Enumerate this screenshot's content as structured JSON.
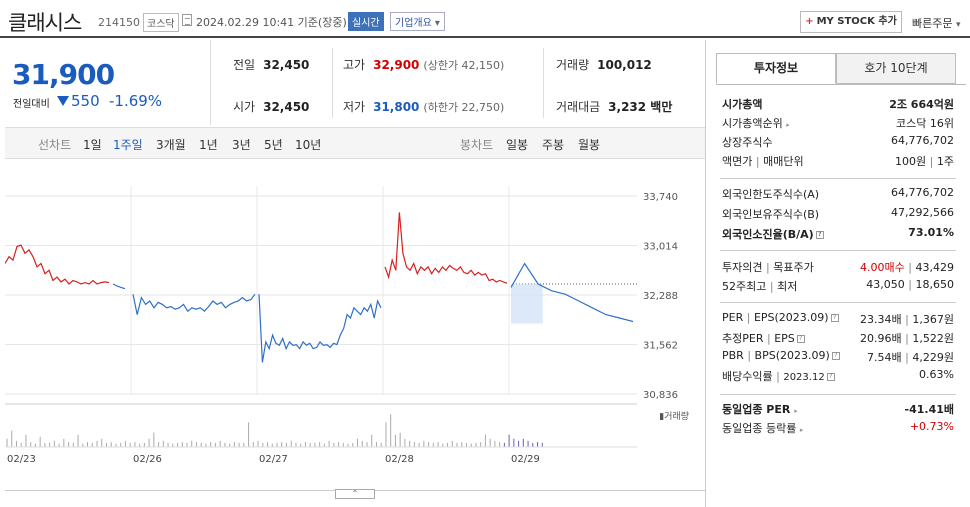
{
  "header": {
    "company": "클래시스",
    "code": "214150",
    "market": "코스닥",
    "timestamp": "2024.02.29 10:41 기준(장중)",
    "realtime": "실시간",
    "company_info": "기업개요",
    "mystock_label": "MY STOCK 추가",
    "quick_order": "빠른주문"
  },
  "price": {
    "current": "31,900",
    "change_label": "전일대비",
    "change": "550",
    "change_pct": "-1.69%"
  },
  "stats": {
    "prev_close_k": "전일",
    "prev_close_v": "32,450",
    "open_k": "시가",
    "open_v": "32,450",
    "high_k": "고가",
    "high_v": "32,900",
    "upper_limit": "(상한가 42,150)",
    "low_k": "저가",
    "low_v": "31,800",
    "lower_limit": "(하한가 22,750)",
    "volume_k": "거래량",
    "volume_v": "100,012",
    "amount_k": "거래대금",
    "amount_v": "3,232 백만"
  },
  "period": {
    "line_label": "선차트",
    "line_items": [
      "1일",
      "1주일",
      "3개월",
      "1년",
      "3년",
      "5년",
      "10년"
    ],
    "active": "1주일",
    "candle_label": "봉차트",
    "candle_items": [
      "일봉",
      "주봉",
      "월봉"
    ]
  },
  "chart_data": {
    "type": "line",
    "y_ticks": [
      "33,740",
      "33,014",
      "32,288",
      "31,562",
      "30,836"
    ],
    "ylim": [
      30836,
      33740
    ],
    "x_ticks": [
      "02/23",
      "02/26",
      "02/27",
      "02/28",
      "02/29"
    ],
    "volume_label": "거래량",
    "reference_line": 32450,
    "series": [
      {
        "color": "#d62020",
        "day": 0,
        "values": [
          32750,
          32850,
          32800,
          33000,
          33020,
          32900,
          32950,
          32850,
          32700,
          32750,
          32600,
          32650,
          32500,
          32550,
          32480,
          32520,
          32450,
          32500,
          32480,
          32450,
          32470,
          32450,
          32500,
          32450,
          32470,
          32480,
          32470
        ]
      },
      {
        "color": "#2f6fcb",
        "day": 0,
        "values": [
          32450,
          32420,
          32400,
          32380
        ]
      },
      {
        "color": "#2f6fcb",
        "day": 1,
        "values": [
          32300,
          32000,
          32250,
          32150,
          32200,
          32100,
          32180,
          32150,
          32100,
          32120,
          32080,
          32100,
          32150,
          32050,
          32100,
          32080,
          32100,
          32050,
          32120,
          32200,
          32150,
          32180,
          32100,
          32150,
          32180,
          32200,
          32250,
          32200,
          32220,
          32300
        ]
      },
      {
        "color": "#2f6fcb",
        "day": 2,
        "values": [
          32300,
          31300,
          31600,
          31500,
          31700,
          31580,
          31550,
          31650,
          31500,
          31600,
          31550,
          31560,
          31500,
          31600,
          31550,
          31580,
          31500,
          31520,
          31600,
          31550,
          31560,
          31520,
          31580,
          31560,
          31700,
          31800,
          32000,
          31950,
          32100,
          32050,
          32000,
          32100,
          32050,
          32150,
          31950,
          32200,
          32100
        ]
      },
      {
        "color": "#d62020",
        "day": 3,
        "values": [
          32700,
          32550,
          32800,
          32650,
          33500,
          32900,
          32700,
          32650,
          32750,
          32600,
          32700,
          32650,
          32700,
          32600,
          32680,
          32620,
          32700,
          32650,
          32720,
          32680,
          32650,
          32700,
          32620,
          32600,
          32650,
          32580,
          32620,
          32580,
          32600,
          32500,
          32520,
          32480,
          32500,
          32480,
          32460
        ]
      },
      {
        "color": "#2f6fcb",
        "day": 4,
        "values": [
          32400,
          32750,
          32450,
          32350,
          32300,
          32200,
          32100,
          32000,
          31950,
          31900
        ]
      }
    ],
    "volume_heights": [
      0.2,
      0.4,
      0.15,
      0.1,
      0.3,
      0.12,
      0.08,
      0.25,
      0.1,
      0.1,
      0.15,
      0.08,
      0.2,
      0.12,
      0.1,
      0.3,
      0.08,
      0.12,
      0.1,
      0.15,
      0.2,
      0.1,
      0.12,
      0.08,
      0.1,
      0.15,
      0.1,
      0.12,
      0.08,
      0.1,
      0.2,
      0.35,
      0.12,
      0.15,
      0.1,
      0.08,
      0.1,
      0.12,
      0.1,
      0.15,
      0.12,
      0.1,
      0.08,
      0.12,
      0.1,
      0.15,
      0.1,
      0.08,
      0.12,
      0.1,
      0.1,
      0.6,
      0.12,
      0.15,
      0.1,
      0.12,
      0.08,
      0.1,
      0.12,
      0.1,
      0.15,
      0.1,
      0.08,
      0.12,
      0.1,
      0.1,
      0.12,
      0.08,
      0.15,
      0.1,
      0.12,
      0.1,
      0.08,
      0.1,
      0.2,
      0.15,
      0.12,
      0.3,
      0.12,
      0.1,
      0.6,
      0.8,
      0.3,
      0.35,
      0.2,
      0.15,
      0.12,
      0.1,
      0.15,
      0.12,
      0.1,
      0.12,
      0.08,
      0.1,
      0.15,
      0.1,
      0.12,
      0.1,
      0.08,
      0.1,
      0.12,
      0.3,
      0.2,
      0.15,
      0.12,
      0.1,
      0.3,
      0.2,
      0.15,
      0.2,
      0.15,
      0.1,
      0.12,
      0.1
    ]
  },
  "side": {
    "tab_invest": "투자정보",
    "tab_quote": "호가 10단계",
    "mktcap_k": "시가총액",
    "mktcap_v": "2조 664억원",
    "rank_k": "시가총액순위",
    "rank_v": "코스닥 16위",
    "shares_k": "상장주식수",
    "shares_v": "64,776,702",
    "par_k": "액면가",
    "par_k2": "매매단위",
    "par_v": "100원",
    "par_v2": "1주",
    "foreign_limit_k": "외국인한도주식수(A)",
    "foreign_limit_v": "64,776,702",
    "foreign_hold_k": "외국인보유주식수(B)",
    "foreign_hold_v": "47,292,566",
    "foreign_ratio_k": "외국인소진율(B/A)",
    "foreign_ratio_v": "73.01%",
    "opinion_k": "투자의견",
    "target_k": "목표주가",
    "opinion_v": "4.00매수",
    "target_v": "43,429",
    "w52_k": "52주최고",
    "w52_k2": "최저",
    "w52_high": "43,050",
    "w52_low": "18,650",
    "per_k": "PER",
    "eps_k": "EPS(2023.09)",
    "per_v": "23.34배",
    "eps_v": "1,367원",
    "fper_k": "추정PER",
    "feps_k": "EPS",
    "fper_v": "20.96배",
    "feps_v": "1,522원",
    "pbr_k": "PBR",
    "bps_k": "BPS(2023.09)",
    "pbr_v": "7.54배",
    "bps_v": "4,229원",
    "div_k": "배당수익률",
    "div_date": "2023.12",
    "div_v": "0.63%",
    "ind_per_k": "동일업종 PER",
    "ind_per_v": "-41.41배",
    "ind_chg_k": "동일업종 등락률",
    "ind_chg_v": "+0.73%"
  }
}
